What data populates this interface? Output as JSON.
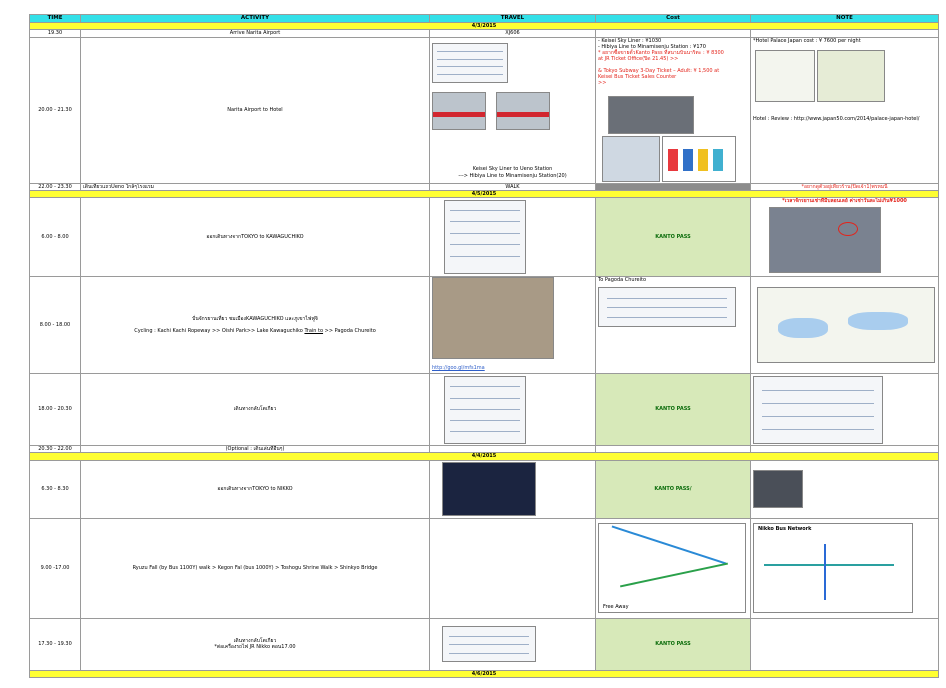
{
  "headers": [
    "TIME",
    "ACTIVITY",
    "TRAVEL",
    "Cost",
    "NOTE"
  ],
  "dates": [
    "4/3/2015",
    "4/5/2015",
    "4/4/2015",
    "4/6/2015"
  ],
  "rows": {
    "r1": {
      "time": "19.30",
      "activity": "Arrive Narita Airport",
      "travel": "XJ606"
    },
    "r2": {
      "time": "20.00 - 21.30",
      "activity": "Narita Airport to Hotel",
      "travel_caption_1": "Keisei Sky Liner to Ueno Station",
      "travel_caption_2": "---> Hibiya Line to  Minamisenju Station(20)",
      "cost_1": "- Keisei Sky Liner : ¥1030",
      "cost_2": "- Hibiya Line to  Minamisenju Station : ¥170",
      "cost_3": "* อยากซื้อขายตั๋วKanto Pass ที่สนามบินนาริตะ : ¥ 8300",
      "cost_4": "at JR Ticket Office(ปิด 21.45) >>",
      "cost_5": "& Tokyo Subway 3-Day Ticket – Adult: ¥ 1,500 at",
      "cost_6": "Keisei Bus Ticket Sales Counter",
      "cost_7": ">>",
      "note_1": "*Hotel Palace Japan cost : ¥ 7600 per night",
      "note_2": "Hotel : Review : http://www.japan50.com/2014/palace-japan-hotel/"
    },
    "r3": {
      "time": "22.00 - 23.30",
      "activity": "เดินเที่ยวแถวUeno ใกล้ๆโรงแรม",
      "travel": "WALK",
      "note": "*อยากดูตั๋วอยู่เที่ยวร้าน(ปิดเจ้า1)พรหมนี้"
    },
    "r4": {
      "time": "6.00 - 8.00",
      "activity": "ออกเดินทางจากTOKYO to KAWAGUCHIKO",
      "cost": "KANTO PASS",
      "note": "*เวลาจักรยานเช่าที่มีบลอนเลย์ ค่าเช่าวันละไม่เกิน¥1000"
    },
    "r5": {
      "time": "8.00 - 18.00",
      "activity_1": "ปั่นจักรยานเที่ยว ชมเมืองKAWAGUCHIKO และภูเขาไฟฟูจิ",
      "activity_2a": "Cycling :  Kachi Kachi Ropeway >> Oishi Park>> Lake Kawaguchiko ",
      "activity_2b": "Train to",
      "activity_2c": " >> Pagoda Chureito",
      "travel_link": "http://goo.gl/mfs1ma",
      "cost": "To Pagoda Chureito"
    },
    "r6": {
      "time": "18.00 - 20.30",
      "activity": "เดินทางกลับโตเกียว",
      "cost": "KANTO PASS"
    },
    "r7": {
      "time": "20.30 - 22.00",
      "activity": "(Optional : เดินเล่นที่อื่นๆ)"
    },
    "r8": {
      "time": "6.30 - 8.30",
      "activity": "ออกเดินทางจากTOKYO to NIKKO",
      "cost": "KANTO PASS/"
    },
    "r9": {
      "time": "9.00 -17.00",
      "activity": "Ryuzu Fall (by Bus 1100Y) walk > Kegon Fal (bus 1000Y) > Toshogu Shrine Walk > Shinkyo Bridge",
      "travel_label": "Free Away",
      "note_label": "Nikko Bus Network"
    },
    "r10": {
      "time": "17.30 - 19.30",
      "activity_1": "เดินทางกลับโตเกียว",
      "activity_2": "*ต่อเครื่องรถไฟ JR Nikko ตอน17.00",
      "cost": "KANTO PASS"
    }
  }
}
